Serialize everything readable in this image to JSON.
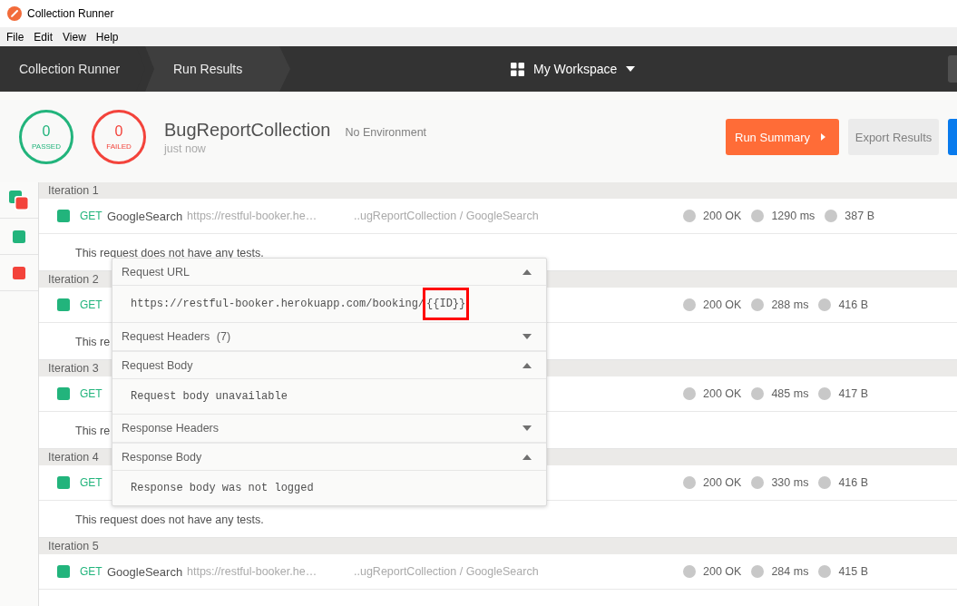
{
  "window": {
    "title": "Collection Runner"
  },
  "menu": [
    "File",
    "Edit",
    "View",
    "Help"
  ],
  "nav": {
    "breadcrumbs": [
      {
        "label": "Collection Runner",
        "selected": false
      },
      {
        "label": "Run Results",
        "selected": true
      }
    ],
    "workspace": "My Workspace"
  },
  "summary": {
    "counters": [
      {
        "kind": "passed",
        "count": "0",
        "label": "PASSED"
      },
      {
        "kind": "failed",
        "count": "0",
        "label": "FAILED"
      }
    ],
    "collection": "BugReportCollection",
    "environment": "No Environment",
    "time": "just now",
    "buttons": [
      {
        "kind": "primary",
        "label": "Run Summary"
      },
      {
        "kind": "secondary",
        "label": "Export Results"
      },
      {
        "kind": "partial"
      }
    ]
  },
  "filters": [
    {
      "kind": "all"
    },
    {
      "kind": "passed"
    },
    {
      "kind": "failed"
    }
  ],
  "iterations": [
    {
      "label": "Iteration 1",
      "request": {
        "passed": true,
        "method": "GET",
        "name": "GoogleSearch",
        "url": "https://restful-booker.he…",
        "path": "..ugReportCollection / GoogleSearch",
        "status": "200 OK",
        "time": "1290 ms",
        "size": "387 B"
      },
      "note": "This request does not have any tests."
    },
    {
      "label": "Iteration 2",
      "request": {
        "passed": true,
        "method": "GET",
        "status": "200 OK",
        "time": "288 ms",
        "size": "416 B"
      },
      "note": "This re"
    },
    {
      "label": "Iteration 3",
      "request": {
        "passed": true,
        "method": "GET",
        "status": "200 OK",
        "time": "485 ms",
        "size": "417 B"
      },
      "note": "This re"
    },
    {
      "label": "Iteration 4",
      "request": {
        "passed": true,
        "method": "GET",
        "status": "200 OK",
        "time": "330 ms",
        "size": "416 B"
      },
      "note": "This request does not have any tests."
    },
    {
      "label": "Iteration 5",
      "request": {
        "passed": true,
        "method": "GET",
        "name": "GoogleSearch",
        "url": "https://restful-booker.he…",
        "path": "..ugReportCollection / GoogleSearch",
        "status": "200 OK",
        "time": "284 ms",
        "size": "415 B"
      }
    }
  ],
  "details": {
    "sections": [
      {
        "title": "Request URL",
        "expanded": true,
        "url": "https://restful-booker.herokuapp.com/booking/",
        "variable": "{{ID}}",
        "variable_highlighted": true
      },
      {
        "title": "Request Headers",
        "count": "(7)",
        "expanded": false
      },
      {
        "title": "Request Body",
        "expanded": true,
        "body": "Request body unavailable"
      },
      {
        "title": "Response Headers",
        "expanded": false
      },
      {
        "title": "Response Body",
        "expanded": true,
        "body": "Response body was not logged"
      }
    ]
  }
}
